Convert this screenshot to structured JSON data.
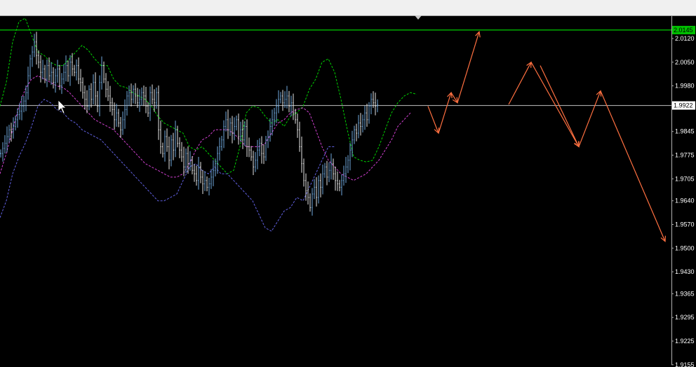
{
  "chart_data": {
    "type": "line",
    "title": "",
    "xlabel": "",
    "ylabel": "",
    "ylim": [
      1.9155,
      2.019
    ],
    "grid": false,
    "y_ticks": [
      "2.0120",
      "2.0050",
      "1.9980",
      "1.9922",
      "1.9845",
      "1.9775",
      "1.9705",
      "1.9640",
      "1.9570",
      "1.9500",
      "1.9430",
      "1.9365",
      "1.9295",
      "1.9225",
      "1.9155"
    ],
    "level_line": {
      "value": 2.0145,
      "label": "2.0145",
      "color": "#00ff00"
    },
    "current_price": {
      "value": 1.9922,
      "label": "1.9922",
      "color": "#c0c0c0"
    },
    "candles": {
      "x_start": 0,
      "x_step": 3,
      "close": [
        1.978,
        1.9795,
        1.981,
        1.983,
        1.985,
        1.9845,
        1.986,
        1.988,
        1.9895,
        1.9905,
        1.992,
        1.9935,
        1.996,
        2.001,
        2.006,
        2.008,
        2.011,
        2.007,
        2.005,
        2.002,
        2.003,
        2.0,
        2.004,
        2.001,
        2.002,
        1.999,
        2.001,
        2.003,
        1.998,
        2.0,
        2.002,
        2.004,
        2.001,
        2.005,
        2.003,
        2.002,
        2.004,
        2.0,
        1.999,
        1.996,
        1.994,
        1.992,
        1.997,
        1.994,
        1.999,
        1.995,
        1.992,
        1.999,
        2.004,
        2.0,
        1.997,
        1.995,
        1.993,
        1.991,
        1.988,
        1.99,
        1.987,
        1.985,
        1.988,
        1.991,
        1.995,
        1.996,
        1.994,
        1.997,
        1.995,
        1.993,
        1.994,
        1.996,
        1.995,
        1.992,
        1.99,
        1.996,
        1.994,
        1.993,
        1.996,
        1.985,
        1.98,
        1.978,
        1.983,
        1.98,
        1.976,
        1.982,
        1.979,
        1.985,
        1.981,
        1.979,
        1.977,
        1.974,
        1.978,
        1.975,
        1.976,
        1.973,
        1.972,
        1.97,
        1.974,
        1.971,
        1.969,
        1.97,
        1.968,
        1.969,
        1.971,
        1.973,
        1.975,
        1.978,
        1.98,
        1.982,
        1.986,
        1.988,
        1.985,
        1.987,
        1.984,
        1.986,
        1.988,
        1.983,
        1.985,
        1.982,
        1.986,
        1.98,
        1.979,
        1.977,
        1.974,
        1.976,
        1.979,
        1.981,
        1.978,
        1.977,
        1.982,
        1.983,
        1.986,
        1.988,
        1.99,
        1.992,
        1.994,
        1.995,
        1.993,
        1.994,
        1.995,
        1.992,
        1.993,
        1.99,
        1.988,
        1.985,
        1.98,
        1.975,
        1.97,
        1.967,
        1.965,
        1.962,
        1.966,
        1.968,
        1.965,
        1.97,
        1.968,
        1.972,
        1.974,
        1.971,
        1.973,
        1.975,
        1.972,
        1.97,
        1.969,
        1.968,
        1.97,
        1.972,
        1.974,
        1.976,
        1.979,
        1.982,
        1.985,
        1.984,
        1.987,
        1.986,
        1.988,
        1.99,
        1.988,
        1.992,
        1.994,
        1.993,
        1.992,
        1.9925
      ],
      "up_color": "#6fa8dc",
      "down_color": "#e6e6e6"
    },
    "series": [
      {
        "role": "upper_band",
        "color": "#00d000",
        "dash": "3,2",
        "values": [
          1.992,
          1.999,
          2.011,
          2.017,
          2.018,
          2.013,
          2.008,
          2.007,
          2.005,
          2.004,
          2.004,
          2.006,
          2.008,
          2.01,
          2.0085,
          2.006,
          2.004,
          2.004,
          2.0,
          1.998,
          1.9975,
          1.996,
          1.995,
          1.994,
          1.992,
          1.989,
          1.987,
          1.986,
          1.985,
          1.984,
          1.98,
          1.979,
          1.98,
          1.978,
          1.976,
          1.974,
          1.972,
          1.973,
          1.98,
          1.99,
          1.992,
          1.9915,
          1.989,
          1.987,
          1.988,
          1.986,
          1.989,
          1.99,
          1.992,
          1.997,
          2.0,
          2.005,
          2.006,
          2.002,
          1.994,
          1.985,
          1.977,
          1.976,
          1.9755,
          1.976,
          1.98,
          1.985,
          1.99,
          1.993,
          1.995,
          1.996,
          1.9955
        ]
      },
      {
        "role": "middle_band",
        "color": "#d040d0",
        "dash": "3,2",
        "values": [
          1.972,
          1.978,
          1.985,
          1.992,
          1.997,
          2.0,
          2.001,
          2.0,
          1.999,
          1.998,
          1.9975,
          1.996,
          1.994,
          1.992,
          1.99,
          1.988,
          1.987,
          1.986,
          1.985,
          1.983,
          1.981,
          1.979,
          1.977,
          1.975,
          1.974,
          1.973,
          1.972,
          1.971,
          1.971,
          1.972,
          1.975,
          1.979,
          1.982,
          1.983,
          1.985,
          1.985,
          1.985,
          1.984,
          1.982,
          1.98,
          1.98,
          1.98,
          1.981,
          1.984,
          1.987,
          1.988,
          1.99,
          1.991,
          1.9915,
          1.99,
          1.985,
          1.98,
          1.976,
          1.974,
          1.972,
          1.971,
          1.97,
          1.971,
          1.972,
          1.974,
          1.976,
          1.979,
          1.982,
          1.986,
          1.988,
          1.99
        ]
      },
      {
        "role": "lower_band",
        "color": "#6060e0",
        "dash": "3,2",
        "values": [
          1.959,
          1.964,
          1.972,
          1.977,
          1.981,
          1.986,
          1.992,
          1.994,
          1.993,
          1.991,
          1.99,
          1.988,
          1.987,
          1.985,
          1.984,
          1.983,
          1.982,
          1.98,
          1.978,
          1.976,
          1.974,
          1.972,
          1.97,
          1.968,
          1.966,
          1.964,
          1.964,
          1.965,
          1.966,
          1.97,
          1.974,
          1.975,
          1.973,
          1.972,
          1.974,
          1.972,
          1.972,
          1.97,
          1.968,
          1.966,
          1.964,
          1.96,
          1.956,
          1.955,
          1.958,
          1.961,
          1.962,
          1.965,
          1.964,
          1.968,
          1.972,
          1.976,
          1.98,
          1.98
        ]
      }
    ],
    "forecast": {
      "color": "#ff7040",
      "points": [
        [
          610,
          1.992
        ],
        [
          625,
          1.984
        ],
        [
          643,
          1.996
        ],
        [
          652,
          1.993
        ],
        [
          683,
          2.014
        ],
        [
          725,
          1.9925
        ],
        [
          757,
          2.005
        ],
        [
          825,
          1.98
        ],
        [
          856,
          1.9965
        ],
        [
          948,
          1.952
        ]
      ],
      "breaks": [
        4
      ]
    }
  }
}
